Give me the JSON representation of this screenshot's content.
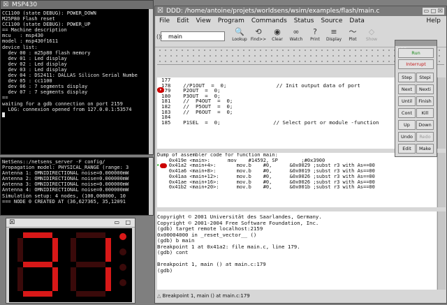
{
  "msp_window": {
    "title": "MSP430",
    "lines": [
      "CC1100 (state DEBUG): POWER_DOWN",
      "M25P80 Flash reset",
      "CC1100 (state DEBUG): POWER_UP",
      "== Machine description",
      "mcu   : msp430",
      "model : msp430f1611",
      "device list:",
      "  dev 00 : m25p80 flash memory",
      "  dev 01 : Led display",
      "  dev 02 : Led display",
      "  dev 03 : Led display",
      "  dev 04 : DS2411: DALLAS Silicon Serial Numbe",
      "  dev 05 : cc1100",
      "  dev 06 : 7 segments display",
      "  dev 07 : 7 segments display",
      "==",
      "waiting for a gdb connection on port 2159",
      "  LOG: connexion opened from 127.0.0.1:53574"
    ]
  },
  "netsens_window": {
    "lines": [
      "NetSens::/netsens_server -F config/",
      "Propagation model: PHYSICAL_RANGE (range: 3",
      "Antenna 1: OMNIDIRECTIONAL noise=0.000000mW",
      "Antenna 2: OMNIDIRECTIONAL noise=0.000000mW",
      "Antenna 3: OMNIDIRECTIONAL noise=0.000000mW",
      "Antenna 4: OMNIDIRECTIONAL noise=0.000000mW",
      "Simulation setup: 4 nodes, (100,000000, 10",
      "=== NODE 0 CREATED AT (36,627365, 35,12091"
    ]
  },
  "segment_window": {
    "digits": [
      "3",
      "1"
    ],
    "led_on_color": "#d81818",
    "led_off_color": "#3a0a0a",
    "leds": [
      true,
      false,
      false,
      false
    ]
  },
  "ddd": {
    "title": "DDD: /home/antoine/projets/worldsens/wsim/examples/flash/main.c",
    "menu": [
      "File",
      "Edit",
      "View",
      "Program",
      "Commands",
      "Status",
      "Source",
      "Data"
    ],
    "help": "Help",
    "arg_label": "():",
    "arg_value": "main",
    "toolbar": [
      {
        "icon": "lookup-icon",
        "glyph": "🔍",
        "label": "Lookup",
        "enabled": true
      },
      {
        "icon": "find-icon",
        "glyph": "⟲",
        "label": "Find>>",
        "enabled": true
      },
      {
        "icon": "clear-icon",
        "glyph": "◉",
        "label": "Clear",
        "enabled": true
      },
      {
        "icon": "watch-icon",
        "glyph": "∞",
        "label": "Watch",
        "enabled": true
      },
      {
        "icon": "print-icon",
        "glyph": "?",
        "label": "Print",
        "enabled": true
      },
      {
        "icon": "display-icon",
        "glyph": "≡",
        "label": "Display",
        "enabled": true
      },
      {
        "icon": "plot-icon",
        "glyph": "〜",
        "label": "Plot",
        "enabled": true
      },
      {
        "icon": "show-icon",
        "glyph": "◇",
        "label": "Show",
        "enabled": false
      }
    ],
    "source_lines": [
      {
        "n": "177",
        "t": ""
      },
      {
        "n": "178",
        "t": "    //P1OUT  =  0;                // Init output data of port"
      },
      {
        "n": "179",
        "t": "    P2OUT  =  0;"
      },
      {
        "n": "180",
        "t": "    P3OUT  =  0;"
      },
      {
        "n": "181",
        "t": "    //  P4OUT  =  0;"
      },
      {
        "n": "182",
        "t": "    //  P5OUT  =  0;"
      },
      {
        "n": "183",
        "t": "    //  P6OUT  =  0;"
      },
      {
        "n": "184",
        "t": ""
      },
      {
        "n": "185",
        "t": "    P1SEL  =  0;                 // Select port or module -function"
      }
    ],
    "asm_header": "Dump of assembler code for function main:",
    "asm_lines": [
      "    0x419e <main>:      mov    #14592, SP        ;#0x3900",
      "    0x41a2 <main+4>:       mov.b    #0,      &0x0029 ;subst r3 with As==00",
      "    0x41a6 <main+8>:       mov.b    #0,      &0x0019 ;subst r3 with As==00",
      "    0x41aa <main+12>:      mov.b    #0,      &0x0026 ;subst r3 with As==00",
      "    0x41ae <main+16>:      mov.b    #0,      &0x0026 ;subst r3 with As==00",
      "    0x41b2 <main+20>:      mov.b    #0,      &0x001b ;subst r3 with As==00"
    ],
    "console_lines": [
      "Copyright © 2001 Universität des Saarlandes, Germany.",
      "Copyright © 2001-2004 Free Software Foundation, Inc.",
      "(gdb) target remote localhost:2159",
      "0x00004000 in _reset_vector__ ()",
      "(gdb) b main",
      "Breakpoint 1 at 0x41a2: file main.c, line 179.",
      "(gdb) cont",
      "",
      "Breakpoint 1, main () at main.c:179",
      "(gdb)"
    ],
    "status": "Breakpoint 1, main () at main.c:179"
  },
  "command_tool": {
    "title": "DDD",
    "run": "Run",
    "interrupt": "Interrupt",
    "buttons": [
      [
        "Step",
        "Stepi"
      ],
      [
        "Next",
        "Nexti"
      ],
      [
        "Until",
        "Finish"
      ],
      [
        "Cont",
        "Kill"
      ],
      [
        "Up",
        "Down"
      ],
      [
        "Undo",
        "Redo"
      ],
      [
        "Edit",
        "Make"
      ]
    ]
  }
}
